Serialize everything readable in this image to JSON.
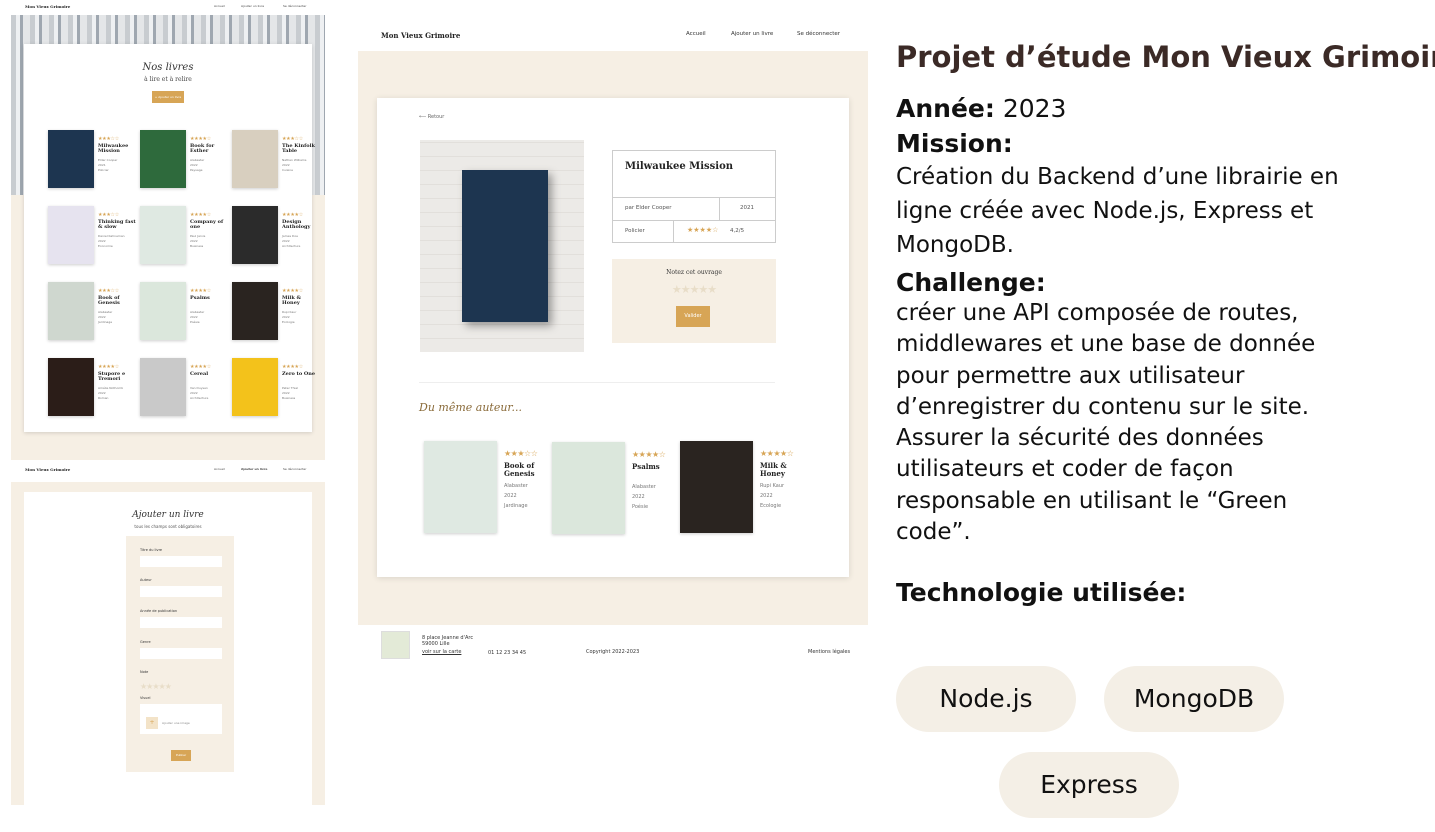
{
  "list_screen": {
    "logo": "Mon Vieux Grimoire",
    "nav": [
      "Accueil",
      "Ajouter un livre",
      "Se déconnecter"
    ],
    "title": "Nos livres",
    "subtitle": "à lire et à relire",
    "add_button": "+ Ajouter un livre",
    "books": [
      {
        "title": "Milwaukee Mission",
        "author": "Elder Cooper",
        "year": "2021",
        "genre": "Policier",
        "stars": "★★★☆☆"
      },
      {
        "title": "Book for Esther",
        "author": "Alabaster",
        "year": "2022",
        "genre": "Paysage",
        "stars": "★★★★☆"
      },
      {
        "title": "The Kinfolk Table",
        "author": "Nathan Williams",
        "year": "2022",
        "genre": "Cuisine",
        "stars": "★★★☆☆"
      },
      {
        "title": "Thinking fast & slow",
        "author": "Daniel Kahneman",
        "year": "2022",
        "genre": "Economie",
        "stars": "★★★☆☆"
      },
      {
        "title": "Company of one",
        "author": "Paul Jarvis",
        "year": "2022",
        "genre": "Business",
        "stars": "★★★★☆"
      },
      {
        "title": "Design Anthology",
        "author": "James Doe",
        "year": "2022",
        "genre": "Architecture",
        "stars": "★★★★☆"
      },
      {
        "title": "Book of Genesis",
        "author": "Alabaster",
        "year": "2022",
        "genre": "Jardinage",
        "stars": "★★★☆☆"
      },
      {
        "title": "Psalms",
        "author": "Alabaster",
        "year": "2022",
        "genre": "Poésie",
        "stars": "★★★★☆"
      },
      {
        "title": "Milk & Honey",
        "author": "Rupi Kaur",
        "year": "2022",
        "genre": "Ecologie",
        "stars": "★★★★☆"
      },
      {
        "title": "Stupore e Tremori",
        "author": "Amélie Nothomb",
        "year": "2022",
        "genre": "Roman",
        "stars": "★★★★☆"
      },
      {
        "title": "Cereal",
        "author": "Van Duysen",
        "year": "2022",
        "genre": "Architecture",
        "stars": "★★★★☆"
      },
      {
        "title": "Zero to One",
        "author": "Peter Thiel",
        "year": "2022",
        "genre": "Business",
        "stars": "★★★★☆"
      }
    ]
  },
  "add_screen": {
    "logo": "Mon Vieux Grimoire",
    "nav": [
      "Accueil",
      "Ajouter un livre",
      "Se déconnecter"
    ],
    "title": "Ajouter un livre",
    "subtitle": "tous les champs sont obligatoires",
    "fields": [
      "Titre du livre",
      "Auteur",
      "Année de publication",
      "Genre"
    ],
    "rating_label": "Note",
    "stars": "★★★★★",
    "visual_label": "Visuel",
    "upload_plus": "+",
    "upload_label": "Ajouter une image",
    "publish_button": "Publier"
  },
  "detail_screen": {
    "logo": "Mon Vieux Grimoire",
    "nav": [
      "Accueil",
      "Ajouter un livre",
      "Se déconnecter"
    ],
    "back": "⟵ Retour",
    "book": {
      "title": "Milwaukee Mission",
      "author": "par Elder Cooper",
      "year": "2021",
      "genre": "Policier",
      "stars": "★★★★☆",
      "rating": "4,2/5"
    },
    "rate_title": "Notez cet ouvrage",
    "rate_stars": "★★★★★",
    "validate_button": "Valider",
    "same_author_title": "Du même auteur...",
    "same_author": [
      {
        "title": "Book of Genesis",
        "author": "Alabaster",
        "year": "2022",
        "genre": "Jardinage",
        "stars": "★★★☆☆"
      },
      {
        "title": "Psalms",
        "author": "Alabaster",
        "year": "2022",
        "genre": "Poésie",
        "stars": "★★★★☆"
      },
      {
        "title": "Milk & Honey",
        "author": "Rupi Kaur",
        "year": "2022",
        "genre": "Ecologie",
        "stars": "★★★★☆"
      }
    ],
    "footer": {
      "address": "8 place Jeanne d'Arc",
      "city": "59000 Lille",
      "map_link": "voir sur la carte",
      "phone": "01 12 23 34 45",
      "copyright": "Copyright 2022-2023",
      "legal": "Mentions légales"
    }
  },
  "description": {
    "title": "Projet d’étude Mon Vieux Grimoire",
    "year_label": "Année:",
    "year": "2023",
    "mission_label": "Mission:",
    "mission": "Création du Backend d’une librairie en ligne créée avec Node.js, Express et MongoDB.",
    "challenge_label": "Challenge:",
    "challenge": "créer une API composée de routes, middlewares et  une base de donnée pour permettre aux utilisateur d’enregistrer du contenu sur le site. Assurer la sécurité des données utilisateurs et coder de façon responsable en utilisant le “Green code”.",
    "tech_label": "Technologie utilisée:",
    "technologies": [
      "Node.js",
      "MongoDB",
      "Express"
    ]
  }
}
